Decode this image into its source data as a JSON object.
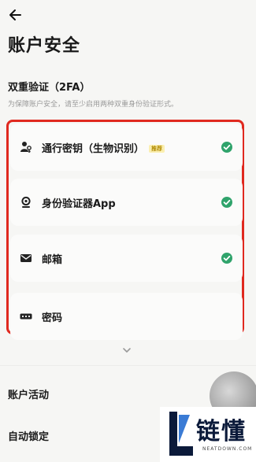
{
  "header": {
    "title": "账户安全"
  },
  "two_fa": {
    "title": "双重验证（2FA）",
    "subtitle": "为保障账户安全，请至少启用两种双重身份验证形式。",
    "items": [
      {
        "label": "通行密钥（生物识别）",
        "badge": "推荐",
        "icon": "passkey-icon",
        "enabled": true
      },
      {
        "label": "身份验证器App",
        "icon": "authenticator-icon",
        "enabled": true
      },
      {
        "label": "邮箱",
        "icon": "mail-icon",
        "enabled": true
      },
      {
        "label": "密码",
        "icon": "password-icon",
        "enabled": false
      }
    ]
  },
  "more_rows": [
    {
      "label": "账户活动"
    },
    {
      "label": "自动锁定"
    }
  ],
  "watermark": {
    "name": "链懂",
    "domain": "NEATDOWN.COM"
  },
  "colors": {
    "accent_green": "#2fa36b",
    "highlight_red": "#e0291f"
  }
}
